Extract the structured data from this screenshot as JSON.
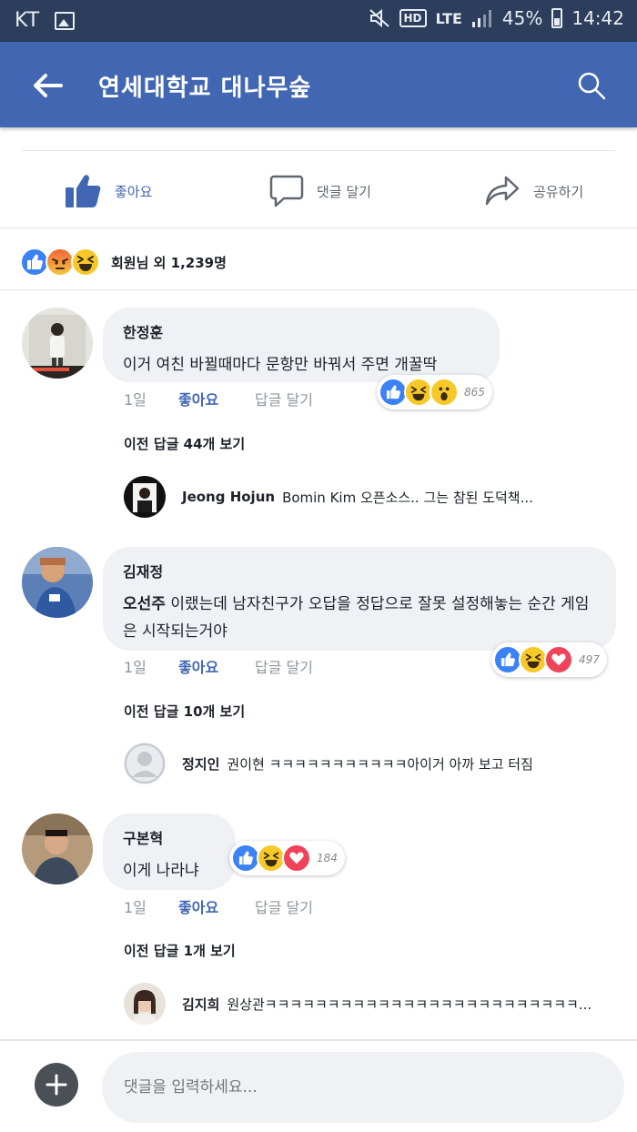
{
  "status_bar": {
    "carrier": "KT",
    "network": "LTE",
    "hd": "HD",
    "battery": "45%",
    "time": "14:42"
  },
  "header": {
    "title": "연세대학교 대나무숲",
    "back_icon": "arrow-left-icon",
    "search_icon": "search-icon"
  },
  "actions": {
    "like": "좋아요",
    "comment": "댓글 달기",
    "share": "공유하기"
  },
  "reaction_summary": {
    "text": "회원님 외 1,239명",
    "icons": [
      "like-icon",
      "angry-icon",
      "haha-icon"
    ]
  },
  "comments": [
    {
      "author": "한정훈",
      "mention": "",
      "text": "이거 여친 바뀔때마다 문항만 바꿔서 주면 개꿀딱",
      "time": "1일",
      "like": "좋아요",
      "reply": "답글 달기",
      "reaction_count": "865",
      "reactions": [
        "like-icon",
        "haha-icon",
        "wow-icon"
      ],
      "prev_replies": "이전 답글 44개 보기",
      "reply_author": "Jeong Hojun",
      "reply_text": "Bomin Kim 오픈소스.. 그는 참된 도덕책..."
    },
    {
      "author": "김재정",
      "mention": "오선주",
      "text": " 이랬는데 남자친구가 오답을 정답으로 잘못 설정해놓는 순간 게임은 시작되는거야",
      "time": "1일",
      "like": "좋아요",
      "reply": "답글 달기",
      "reaction_count": "497",
      "reactions": [
        "like-icon",
        "haha-icon",
        "love-icon"
      ],
      "prev_replies": "이전 답글 10개 보기",
      "reply_author": "정지인",
      "reply_text": "권이현 ㅋㅋㅋㅋㅋㅋㅋㅋㅋㅋㅋ아이거 아까 보고 터짐"
    },
    {
      "author": "구본혁",
      "mention": "",
      "text": "이게 나라냐",
      "time": "1일",
      "like": "좋아요",
      "reply": "답글 달기",
      "reaction_count": "184",
      "reactions": [
        "like-icon",
        "haha-icon",
        "love-icon"
      ],
      "prev_replies": "이전 답글 1개 보기",
      "reply_author": "김지희",
      "reply_text": "원상관ㅋㅋㅋㅋㅋㅋㅋㅋㅋㅋㅋㅋㅋㅋㅋㅋㅋㅋㅋㅋㅋㅋㅋㅋㅋ..."
    }
  ],
  "composer": {
    "placeholder": "댓글을 입력하세요..."
  },
  "colors": {
    "brand": "#4267b2",
    "status_bar": "#2c3e5c",
    "like_blue": "#3b82f6",
    "love_red": "#f0435a",
    "haha_yellow": "#f7c928"
  }
}
